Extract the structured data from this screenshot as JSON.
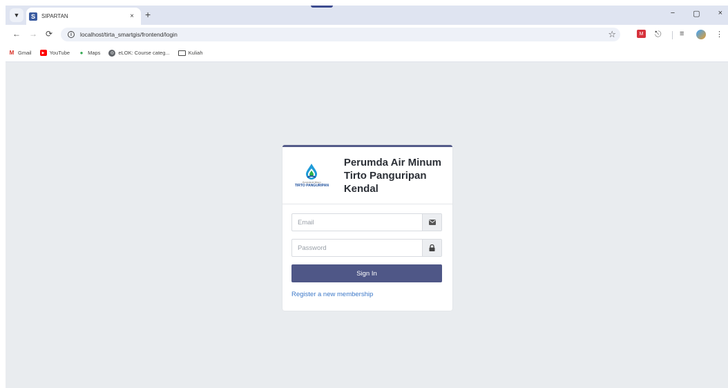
{
  "browser": {
    "tab_title": "SIPARTAN",
    "tab_favicon_letter": "S",
    "tab_close": "×",
    "new_tab": "+",
    "url": "localhost/tirta_smartgis/frontend/login",
    "window_controls": {
      "minimize": "−",
      "restore": "▢",
      "close": "×"
    },
    "bookmarks": [
      {
        "label": "Gmail",
        "icon": "gmail-icon"
      },
      {
        "label": "YouTube",
        "icon": "youtube-icon"
      },
      {
        "label": "Maps",
        "icon": "maps-icon"
      },
      {
        "label": "eLOK: Course categ...",
        "icon": "globe-icon"
      },
      {
        "label": "Kuliah",
        "icon": "folder-icon"
      }
    ]
  },
  "login": {
    "logo_small_text": "Perumda Air Minum",
    "logo_brand": "TIRTO PANGURIPAN",
    "company_name": "Perumda Air Minum Tirto Panguripan Kendal",
    "email_placeholder": "Email",
    "password_placeholder": "Password",
    "signin_label": "Sign In",
    "register_label": "Register a new membership"
  },
  "colors": {
    "page_background": "#e9ecef",
    "card_accent": "#535a89",
    "button": "#4f5787",
    "link": "#3c78c8"
  }
}
